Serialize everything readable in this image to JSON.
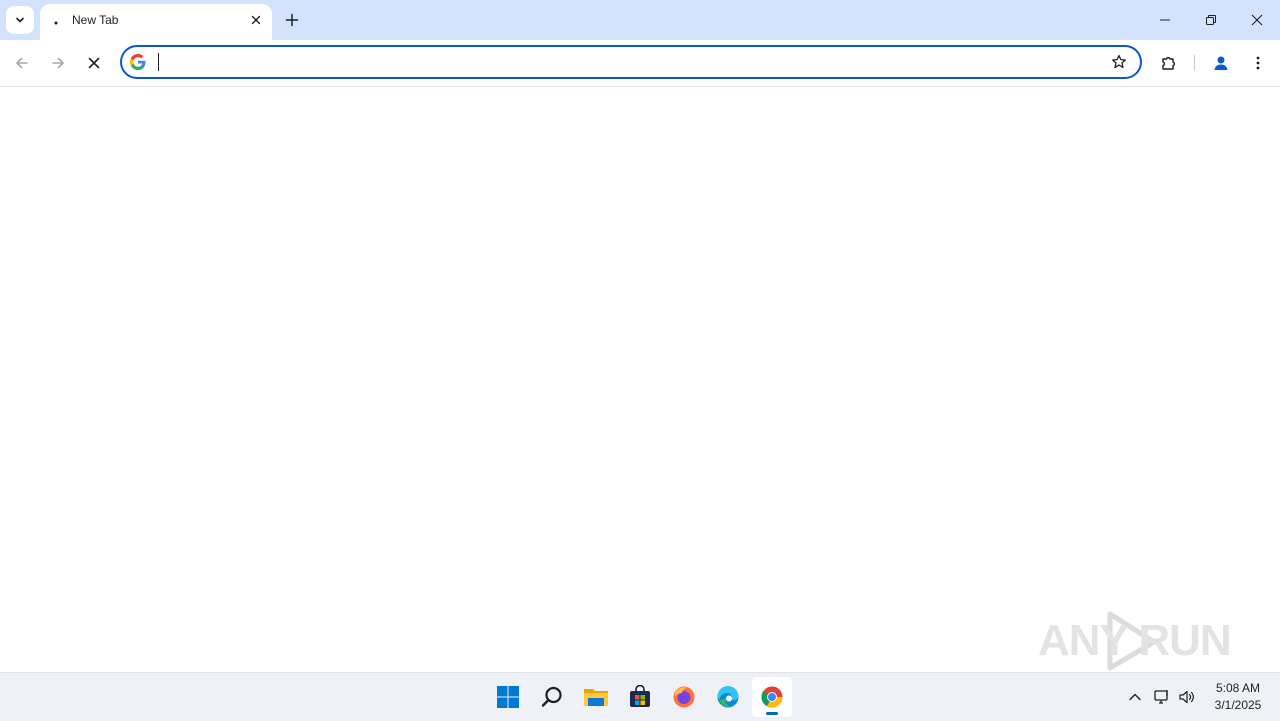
{
  "browser": {
    "tab": {
      "title": "New Tab",
      "close_label": "×"
    },
    "omnibox": {
      "value": "",
      "placeholder": ""
    }
  },
  "watermark": {
    "text": "ANY RUN"
  },
  "taskbar": {
    "apps": [
      "start",
      "search",
      "file-explorer",
      "microsoft-store",
      "firefox",
      "edge",
      "chrome"
    ],
    "active_app": "chrome"
  },
  "clock": {
    "time": "5:08 AM",
    "date": "3/1/2025"
  },
  "colors": {
    "accent": "#0b57d0",
    "tabstrip": "#d3e3fd",
    "taskbar": "#eef2f7"
  }
}
